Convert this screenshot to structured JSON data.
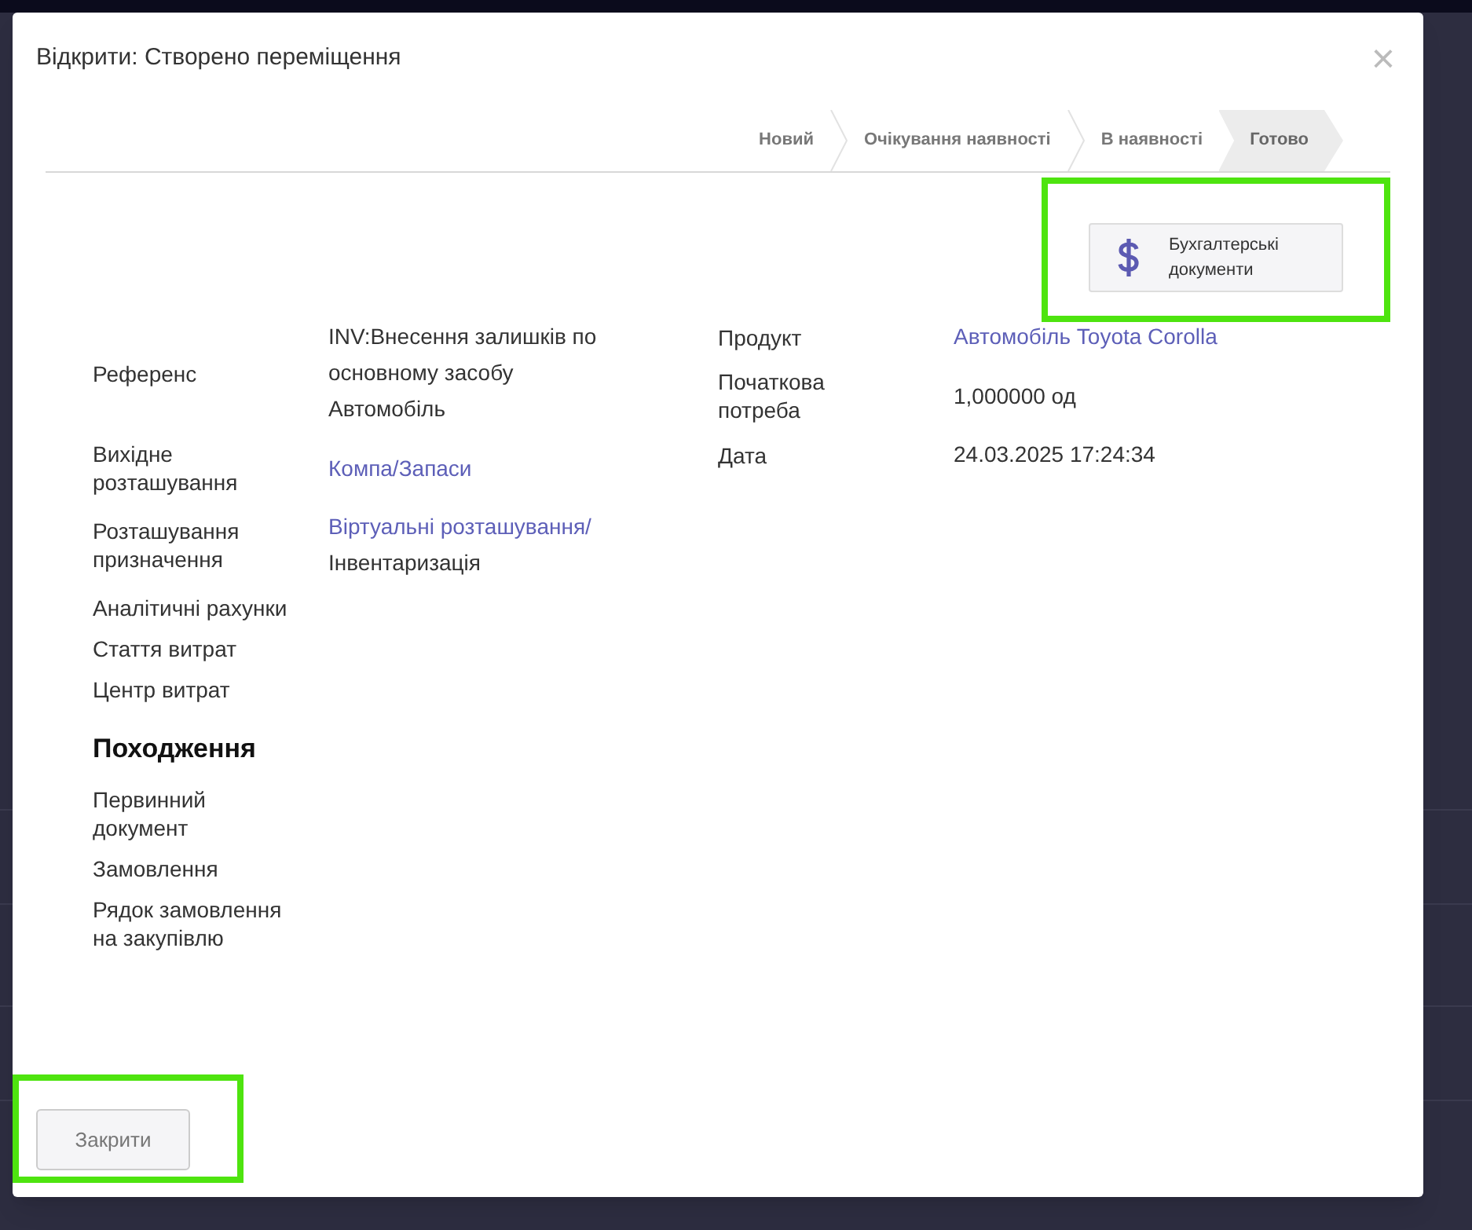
{
  "dialog": {
    "title": "Відкрити: Створено переміщення",
    "close": "×"
  },
  "stages": [
    {
      "label": "Новий",
      "selected": false
    },
    {
      "label": "Очікування наявності",
      "selected": false
    },
    {
      "label": "В наявності",
      "selected": false
    },
    {
      "label": "Готово",
      "selected": true
    }
  ],
  "smart_button": {
    "label": "Бухгалтерські документи",
    "highlighted": true
  },
  "left_fields": [
    {
      "kind": "field",
      "label": "Референс",
      "value": [
        {
          "text": "INV:Внесення залишків по основному засобу Автомобіль",
          "link": false
        }
      ]
    },
    {
      "kind": "field",
      "label": "Вихідне розташування",
      "value": [
        {
          "text": "Компа/Запаси",
          "link": true
        }
      ]
    },
    {
      "kind": "field",
      "label": "Розташування призначення",
      "value": [
        {
          "text": "Віртуальні розташування/",
          "link": true
        },
        {
          "text": "Інвентаризація",
          "link": false
        }
      ]
    },
    {
      "kind": "field",
      "label": "Аналітичні рахунки"
    },
    {
      "kind": "field",
      "label": "Стаття витрат"
    },
    {
      "kind": "field",
      "label": "Центр витрат"
    },
    {
      "kind": "heading",
      "label": "Походження"
    },
    {
      "kind": "field",
      "label": "Первинний документ"
    },
    {
      "kind": "field",
      "label": "Замовлення"
    },
    {
      "kind": "field",
      "label": "Рядок замовлення на закупівлю"
    }
  ],
  "right_fields": [
    {
      "kind": "field",
      "label": "Продукт",
      "value": [
        {
          "text": "Автомобіль Toyota Corolla",
          "link": true
        }
      ]
    },
    {
      "kind": "field",
      "label": "Початкова потреба",
      "value": [
        {
          "text": "1,000000 од",
          "link": false
        }
      ]
    },
    {
      "kind": "field",
      "label": "Дата",
      "value": [
        {
          "text": "24.03.2025 17:24:34",
          "link": false
        }
      ]
    }
  ],
  "footer": {
    "close_button": {
      "label": "Закрити",
      "highlighted": true
    }
  }
}
